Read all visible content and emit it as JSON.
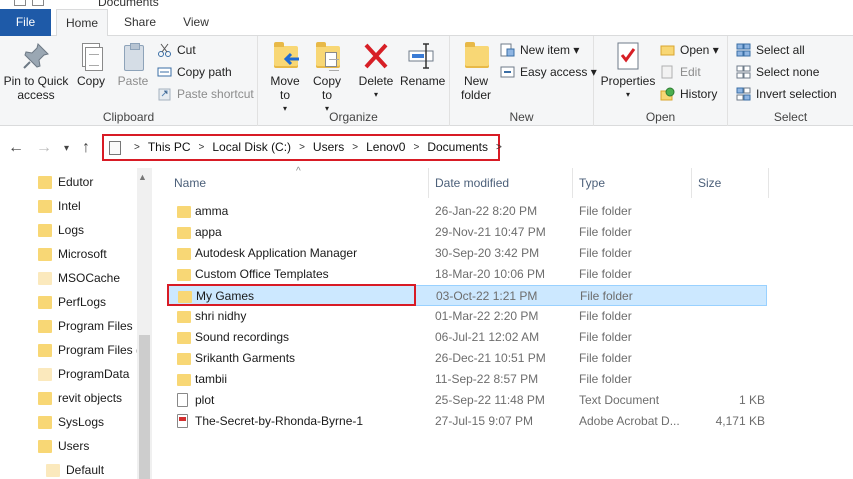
{
  "window": {
    "title": "Documents"
  },
  "tabs": [
    "File",
    "Home",
    "Share",
    "View"
  ],
  "ribbon": {
    "clipboard": {
      "label": "Clipboard",
      "pin_to_quick_access": "Pin to Quick access",
      "copy": "Copy",
      "paste": "Paste",
      "cut": "Cut",
      "copy_path": "Copy path",
      "paste_shortcut": "Paste shortcut"
    },
    "organize": {
      "label": "Organize",
      "move_to": "Move to",
      "copy_to": "Copy to",
      "delete": "Delete",
      "rename": "Rename"
    },
    "new": {
      "label": "New",
      "new_folder": "New folder",
      "new_item": "New item",
      "easy_access": "Easy access"
    },
    "open": {
      "label": "Open",
      "properties": "Properties",
      "open": "Open",
      "edit": "Edit",
      "history": "History"
    },
    "select": {
      "label": "Select",
      "select_all": "Select all",
      "select_none": "Select none",
      "invert_selection": "Invert selection"
    }
  },
  "address": {
    "crumbs": [
      "This PC",
      "Local Disk (C:)",
      "Users",
      "Lenov0",
      "Documents"
    ]
  },
  "nav_pane": {
    "items": [
      {
        "label": "Edutor",
        "pale": false
      },
      {
        "label": "Intel",
        "pale": false
      },
      {
        "label": "Logs",
        "pale": false
      },
      {
        "label": "Microsoft",
        "pale": false
      },
      {
        "label": "MSOCache",
        "pale": true
      },
      {
        "label": "PerfLogs",
        "pale": false
      },
      {
        "label": "Program Files",
        "pale": false
      },
      {
        "label": "Program Files (",
        "pale": false
      },
      {
        "label": "ProgramData",
        "pale": true
      },
      {
        "label": "revit objects",
        "pale": false
      },
      {
        "label": "SysLogs",
        "pale": false
      },
      {
        "label": "Users",
        "pale": false
      },
      {
        "label": "Default",
        "pale": true
      }
    ]
  },
  "columns": {
    "name": "Name",
    "date_modified": "Date modified",
    "type": "Type",
    "size": "Size"
  },
  "files": [
    {
      "name": "amma",
      "modified": "26-Jan-22 8:20 PM",
      "type": "File folder",
      "size": "",
      "kind": "folder"
    },
    {
      "name": "appa",
      "modified": "29-Nov-21 10:47 PM",
      "type": "File folder",
      "size": "",
      "kind": "folder"
    },
    {
      "name": "Autodesk Application Manager",
      "modified": "30-Sep-20 3:42 PM",
      "type": "File folder",
      "size": "",
      "kind": "folder"
    },
    {
      "name": "Custom Office Templates",
      "modified": "18-Mar-20 10:06 PM",
      "type": "File folder",
      "size": "",
      "kind": "folder"
    },
    {
      "name": "My Games",
      "modified": "03-Oct-22 1:21 PM",
      "type": "File folder",
      "size": "",
      "kind": "folder",
      "selected": true
    },
    {
      "name": "shri nidhy",
      "modified": "01-Mar-22 2:20 PM",
      "type": "File folder",
      "size": "",
      "kind": "folder"
    },
    {
      "name": "Sound recordings",
      "modified": "06-Jul-21 12:02 AM",
      "type": "File folder",
      "size": "",
      "kind": "folder"
    },
    {
      "name": "Srikanth Garments",
      "modified": "26-Dec-21 10:51 PM",
      "type": "File folder",
      "size": "",
      "kind": "folder"
    },
    {
      "name": "tambii",
      "modified": "11-Sep-22 8:57 PM",
      "type": "File folder",
      "size": "",
      "kind": "folder"
    },
    {
      "name": "plot",
      "modified": "25-Sep-22 11:48 PM",
      "type": "Text Document",
      "size": "1 KB",
      "kind": "txt"
    },
    {
      "name": "The-Secret-by-Rhonda-Byrne-1",
      "modified": "27-Jul-15 9:07 PM",
      "type": "Adobe Acrobat D...",
      "size": "4,171 KB",
      "kind": "pdf"
    }
  ],
  "colors": {
    "file_tab": "#1e5aa8",
    "highlight": "#d81b25",
    "selection": "#cce8ff"
  }
}
